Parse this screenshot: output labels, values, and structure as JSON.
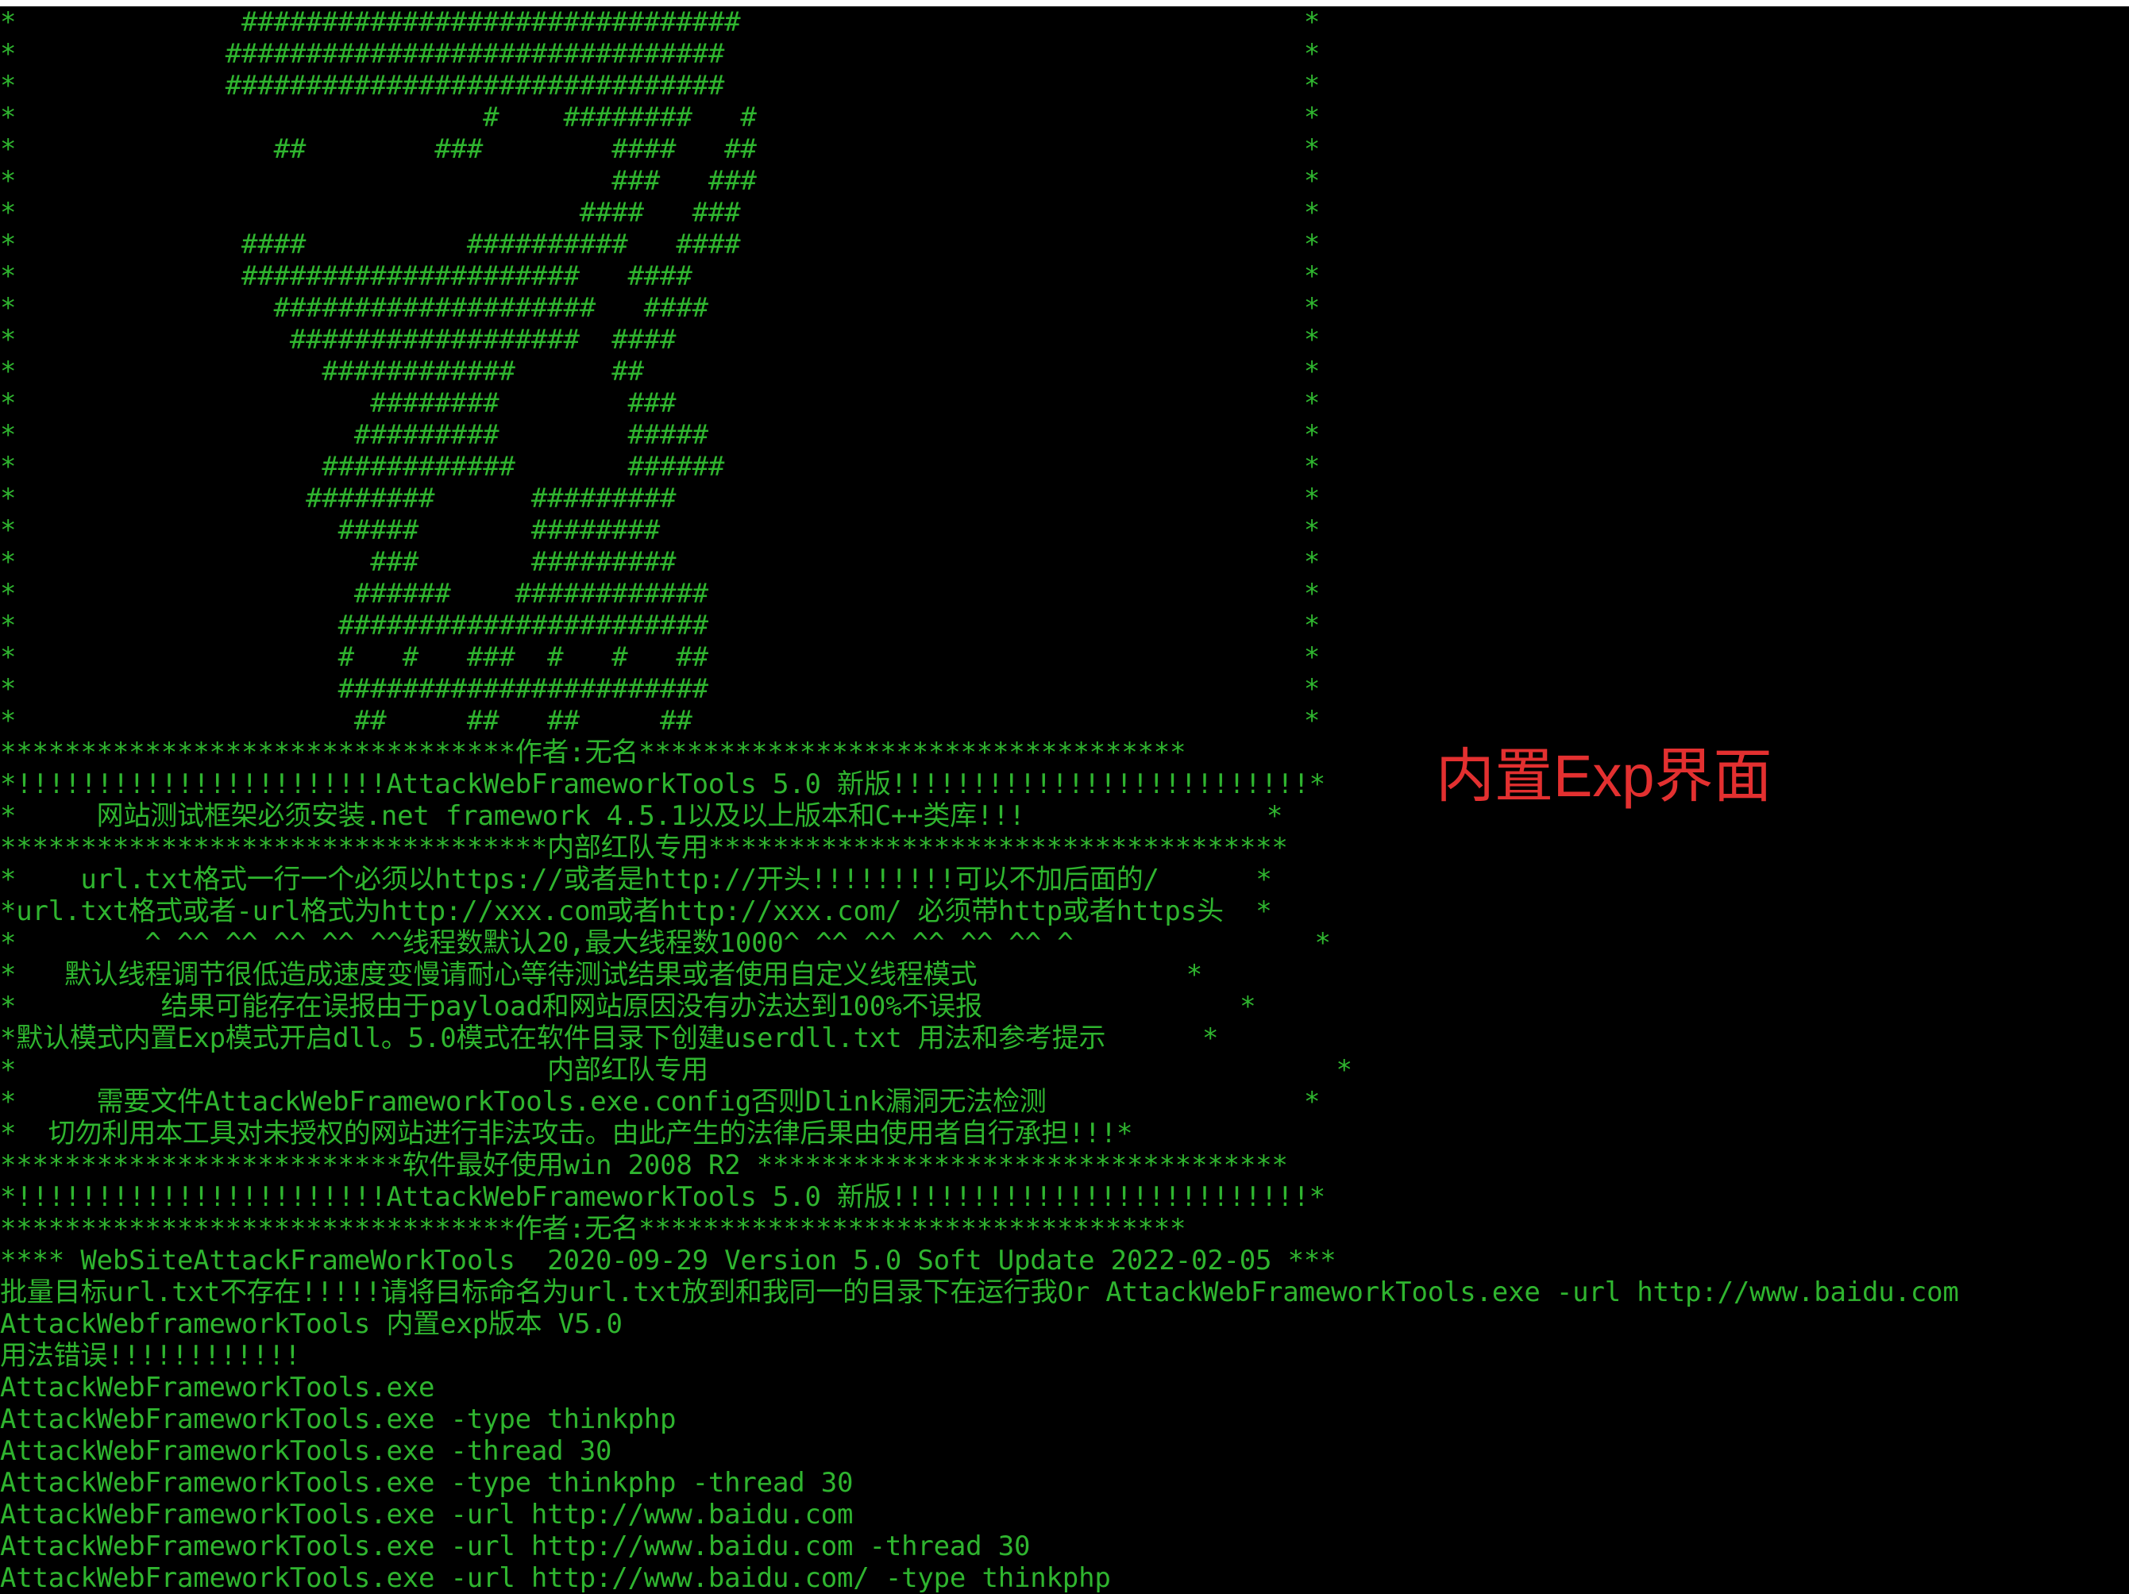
{
  "colors": {
    "background": "#000000",
    "terminal_text": "#2fb52f",
    "annotation": "#e33030"
  },
  "annotation": {
    "text": "内置Exp界面"
  },
  "console_lines": [
    "*              ###############################                                   *",
    "*             ###############################                                    *",
    "*             ###############################                                    *",
    "*                             #    ########   #                                  *",
    "*                ##        ###        ####   ##                                  *",
    "*                                     ###   ###                                  *",
    "*                                   ####   ###                                   *",
    "*              ####          ##########   ####                                   *",
    "*              #####################   ####                                      *",
    "*                ####################   ####                                     *",
    "*                 ##################  ####                                       *",
    "*                   ############      ##                                         *",
    "*                      ########        ###                                       *",
    "*                     #########        #####                                     *",
    "*                   ############       ######                                    *",
    "*                  ########      #########                                       *",
    "*                    #####       ########                                        *",
    "*                      ###       #########                                       *",
    "*                     ######    ############                                     *",
    "*                    #######################                                     *",
    "*                    #   #   ###  #   #   ##                                     *",
    "*                    #######################                                     *",
    "*                     ##     ##   ##     ##                                      *",
    "********************************作者:无名**********************************",
    "*!!!!!!!!!!!!!!!!!!!!!!!AttackWebFrameworkTools 5.0 新版!!!!!!!!!!!!!!!!!!!!!!!!!!*",
    "*     网站测试框架必须安装.net framework 4.5.1以及以上版本和C++类库!!!               *",
    "**********************************内部红队专用************************************",
    "*    url.txt格式一行一个必须以https://或者是http://开头!!!!!!!!!可以不加后面的/      *",
    "*url.txt格式或者-url格式为http://xxx.com或者http://xxx.com/ 必须带http或者https头  *",
    "*        ^ ^^ ^^ ^^ ^^ ^^线程数默认20,最大线程数1000^ ^^ ^^ ^^ ^^ ^^ ^               *",
    "*   默认线程调节很低造成速度变慢请耐心等待测试结果或者使用自定义线程模式             *",
    "*         结果可能存在误报由于payload和网站原因没有办法达到100%不误报                *",
    "*默认模式内置Exp模式开启dll。5.0模式在软件目录下创建userdll.txt 用法和参考提示      *",
    "*                                 内部红队专用                                       *",
    "*     需要文件AttackWebFrameworkTools.exe.config否则Dlink漏洞无法检测                *",
    "*  切勿利用本工具对未授权的网站进行非法攻击。由此产生的法律后果由使用者自行承担!!!*",
    "*************************软件最好使用win 2008 R2 *********************************",
    "*!!!!!!!!!!!!!!!!!!!!!!!AttackWebFrameworkTools 5.0 新版!!!!!!!!!!!!!!!!!!!!!!!!!!*",
    "********************************作者:无名**********************************",
    "**** WebSiteAttackFrameWorkTools  2020-09-29 Version 5.0 Soft Update 2022-02-05 ***",
    "批量目标url.txt不存在!!!!!请将目标命名为url.txt放到和我同一的目录下在运行我Or AttackWebFrameworkTools.exe -url http://www.baidu.com",
    "AttackWebframeworkTools 内置exp版本 V5.0",
    "用法错误!!!!!!!!!!!!",
    "AttackWebFrameworkTools.exe",
    "AttackWebFrameworkTools.exe -type thinkphp",
    "AttackWebFrameworkTools.exe -thread 30",
    "AttackWebFrameworkTools.exe -type thinkphp -thread 30",
    "AttackWebFrameworkTools.exe -url http://www.baidu.com",
    "AttackWebFrameworkTools.exe -url http://www.baidu.com -thread 30",
    "AttackWebFrameworkTools.exe -url http://www.baidu.com/ -type thinkphp"
  ]
}
